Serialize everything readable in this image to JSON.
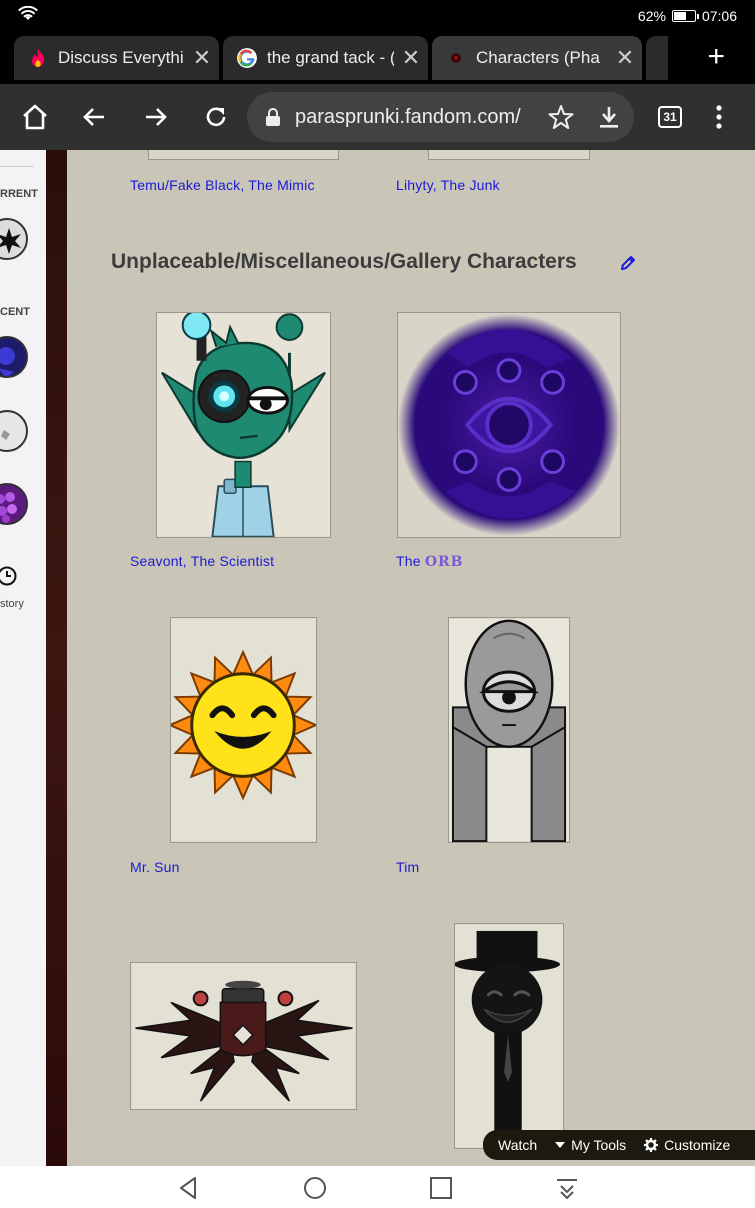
{
  "status": {
    "battery": "62%",
    "battery_level": 0.62,
    "time": "07:06"
  },
  "tabs": [
    {
      "title": "Discuss Everythi",
      "favicon": "fandom-flame-icon",
      "close": "✕"
    },
    {
      "title": "the grand tack - (",
      "favicon": "google-icon",
      "close": "✕"
    },
    {
      "title": "Characters (Pha",
      "favicon": "fandom-dark-icon",
      "close": "✕"
    }
  ],
  "new_tab": "+",
  "toolbar": {
    "url": "parasprunki.fandom.com/",
    "tab_count": "31"
  },
  "rail": {
    "current_label": "RRENT",
    "recent_label": "CENT",
    "history_label": "story"
  },
  "section": {
    "heading": "Unplaceable/Miscellaneous/Gallery Characters"
  },
  "characters": {
    "temu": "Temu/Fake Black, The Mimic",
    "lihyty": "Lihyty, The Junk",
    "seavont": "Seavont, The Scientist",
    "orb_prefix": "The ",
    "orb_name": "ORB",
    "mr_sun": "Mr. Sun",
    "tim": "Tim"
  },
  "tools": {
    "watch": "Watch",
    "my_tools": "My Tools",
    "customize": "Customize"
  },
  "colors": {
    "link": "#1a1ad6",
    "page_bg": "#cac6b7",
    "toolbar": "#303030"
  }
}
